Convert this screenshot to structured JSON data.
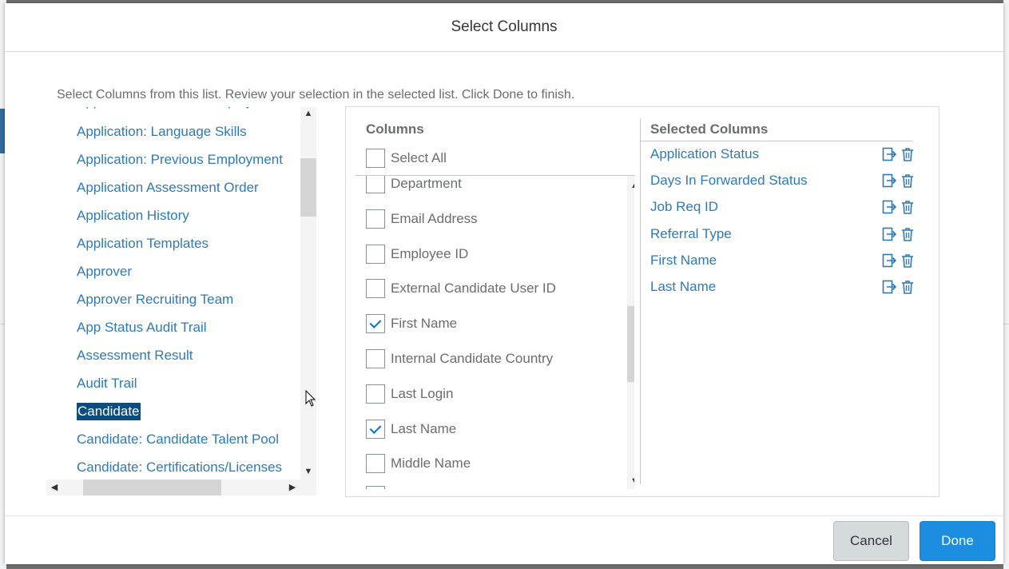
{
  "dialog": {
    "title": "Select Columns",
    "instructions": "Select Columns from this list. Review your selection in the selected list. Click Done to finish."
  },
  "categories": {
    "items": [
      "Application: Language Skills",
      "Application: Previous Employment",
      "Application Assessment Order",
      "Application History",
      "Application Templates",
      "Approver",
      "Approver Recruiting Team",
      "App Status Audit Trail",
      "Assessment Result",
      "Audit Trail",
      "Candidate",
      "Candidate: Candidate Talent Pool",
      "Candidate: Certifications/Licenses"
    ],
    "selected": "Candidate"
  },
  "columns": {
    "header": "Columns",
    "select_all_label": "Select All",
    "items": [
      {
        "label": "Department",
        "checked": false
      },
      {
        "label": "Email Address",
        "checked": false
      },
      {
        "label": "Employee ID",
        "checked": false
      },
      {
        "label": "External Candidate User ID",
        "checked": false
      },
      {
        "label": "First Name",
        "checked": true
      },
      {
        "label": "Internal Candidate Country",
        "checked": false
      },
      {
        "label": "Last Login",
        "checked": false
      },
      {
        "label": "Last Name",
        "checked": true
      },
      {
        "label": "Middle Name",
        "checked": false
      }
    ]
  },
  "selected_columns": {
    "header": "Selected Columns",
    "items": [
      "Application Status",
      "Days In Forwarded Status",
      "Job Req ID",
      "Referral Type",
      "First Name",
      "Last Name"
    ],
    "row_icons": [
      "move-icon",
      "trash-icon"
    ]
  },
  "footer": {
    "cancel_label": "Cancel",
    "done_label": "Done"
  },
  "colors": {
    "link": "#2f7ab5",
    "selected_bg": "#0b4d7e",
    "primary": "#1b8ee0",
    "check": "#0a6ed1"
  }
}
